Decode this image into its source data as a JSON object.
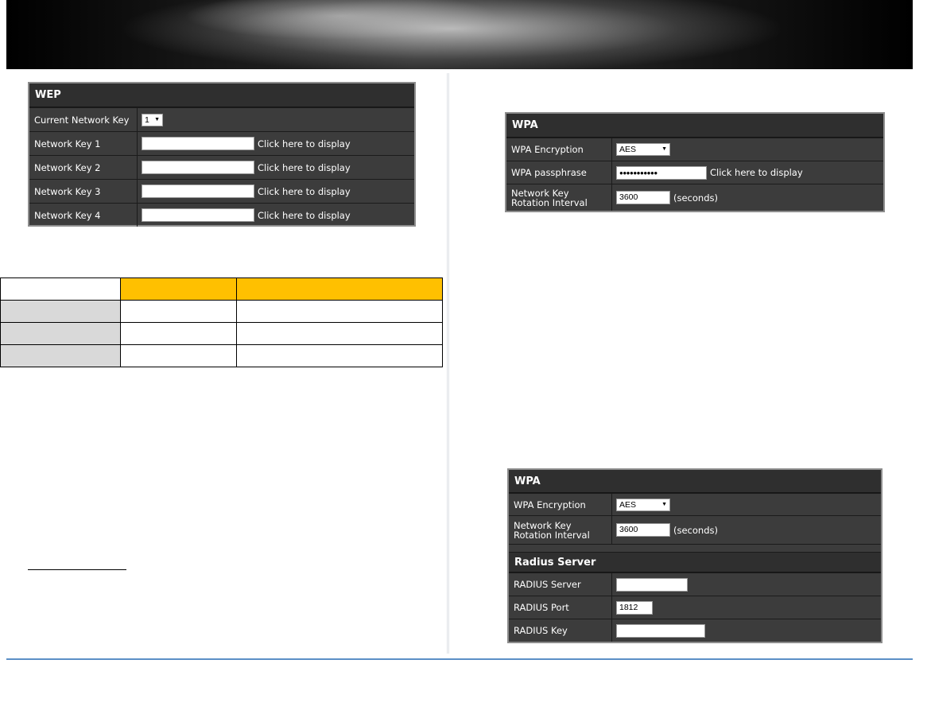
{
  "wep": {
    "title": "WEP",
    "current_key_label": "Current Network Key",
    "current_key_value": "1",
    "keys": [
      {
        "label": "Network Key 1",
        "value": "",
        "link": "Click here to display"
      },
      {
        "label": "Network Key 2",
        "value": "",
        "link": "Click here to display"
      },
      {
        "label": "Network Key 3",
        "value": "",
        "link": "Click here to display"
      },
      {
        "label": "Network Key 4",
        "value": "",
        "link": "Click here to display"
      }
    ]
  },
  "wpa_psk": {
    "title": "WPA",
    "encryption_label": "WPA Encryption",
    "encryption_value": "AES",
    "passphrase_label": "WPA passphrase",
    "passphrase_value": "●●●●●●●●●●●",
    "passphrase_link": "Click here to display",
    "rotation_label": "Network Key Rotation Interval",
    "rotation_value": "3600",
    "rotation_unit": "(seconds)"
  },
  "wpa_enterprise": {
    "title": "WPA",
    "encryption_label": "WPA Encryption",
    "encryption_value": "AES",
    "rotation_label": "Network Key Rotation Interval",
    "rotation_value": "3600",
    "rotation_unit": "(seconds)",
    "radius_title": "Radius Server",
    "radius_server_label": "RADIUS Server",
    "radius_server_value": "",
    "radius_port_label": "RADIUS Port",
    "radius_port_value": "1812",
    "radius_key_label": "RADIUS Key",
    "radius_key_value": ""
  },
  "colors": {
    "panel_bg": "#3c3c3c",
    "header_accent": "#ffc000",
    "shaded_cell": "#d9d9d9",
    "footer_rule": "#5b8fc6"
  }
}
